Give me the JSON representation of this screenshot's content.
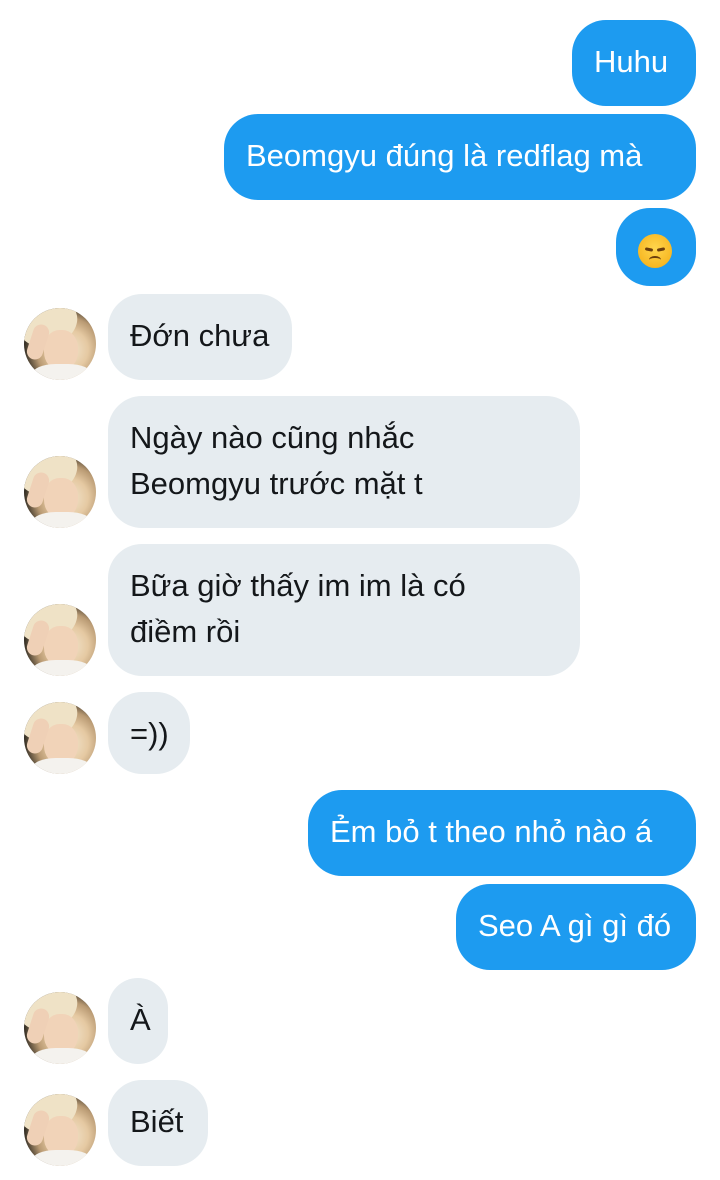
{
  "messages": [
    {
      "id": "m1",
      "direction": "outgoing",
      "text": "Huhu"
    },
    {
      "id": "m2",
      "direction": "outgoing",
      "text": "Beomgyu đúng là redflag mà"
    },
    {
      "id": "m3",
      "direction": "outgoing",
      "emoji": "disappointed-face"
    },
    {
      "id": "m4",
      "direction": "incoming",
      "text": "Đớn chưa"
    },
    {
      "id": "m5",
      "direction": "incoming",
      "text": "Ngày nào cũng nhắc Beomgyu trước mặt t"
    },
    {
      "id": "m6",
      "direction": "incoming",
      "text": "Bữa giờ thấy im im là có điềm rồi"
    },
    {
      "id": "m7",
      "direction": "incoming",
      "text": "=))"
    },
    {
      "id": "m8",
      "direction": "outgoing",
      "text": "Ẻm bỏ t theo nhỏ nào á"
    },
    {
      "id": "m9",
      "direction": "outgoing",
      "text": "Seo A gì gì đó"
    },
    {
      "id": "m10",
      "direction": "incoming",
      "text": "À"
    },
    {
      "id": "m11",
      "direction": "incoming",
      "text": "Biết"
    }
  ],
  "colors": {
    "outgoing_bubble": "#1d9bf0",
    "incoming_bubble": "#e6ecf0",
    "incoming_text": "#14171a"
  }
}
